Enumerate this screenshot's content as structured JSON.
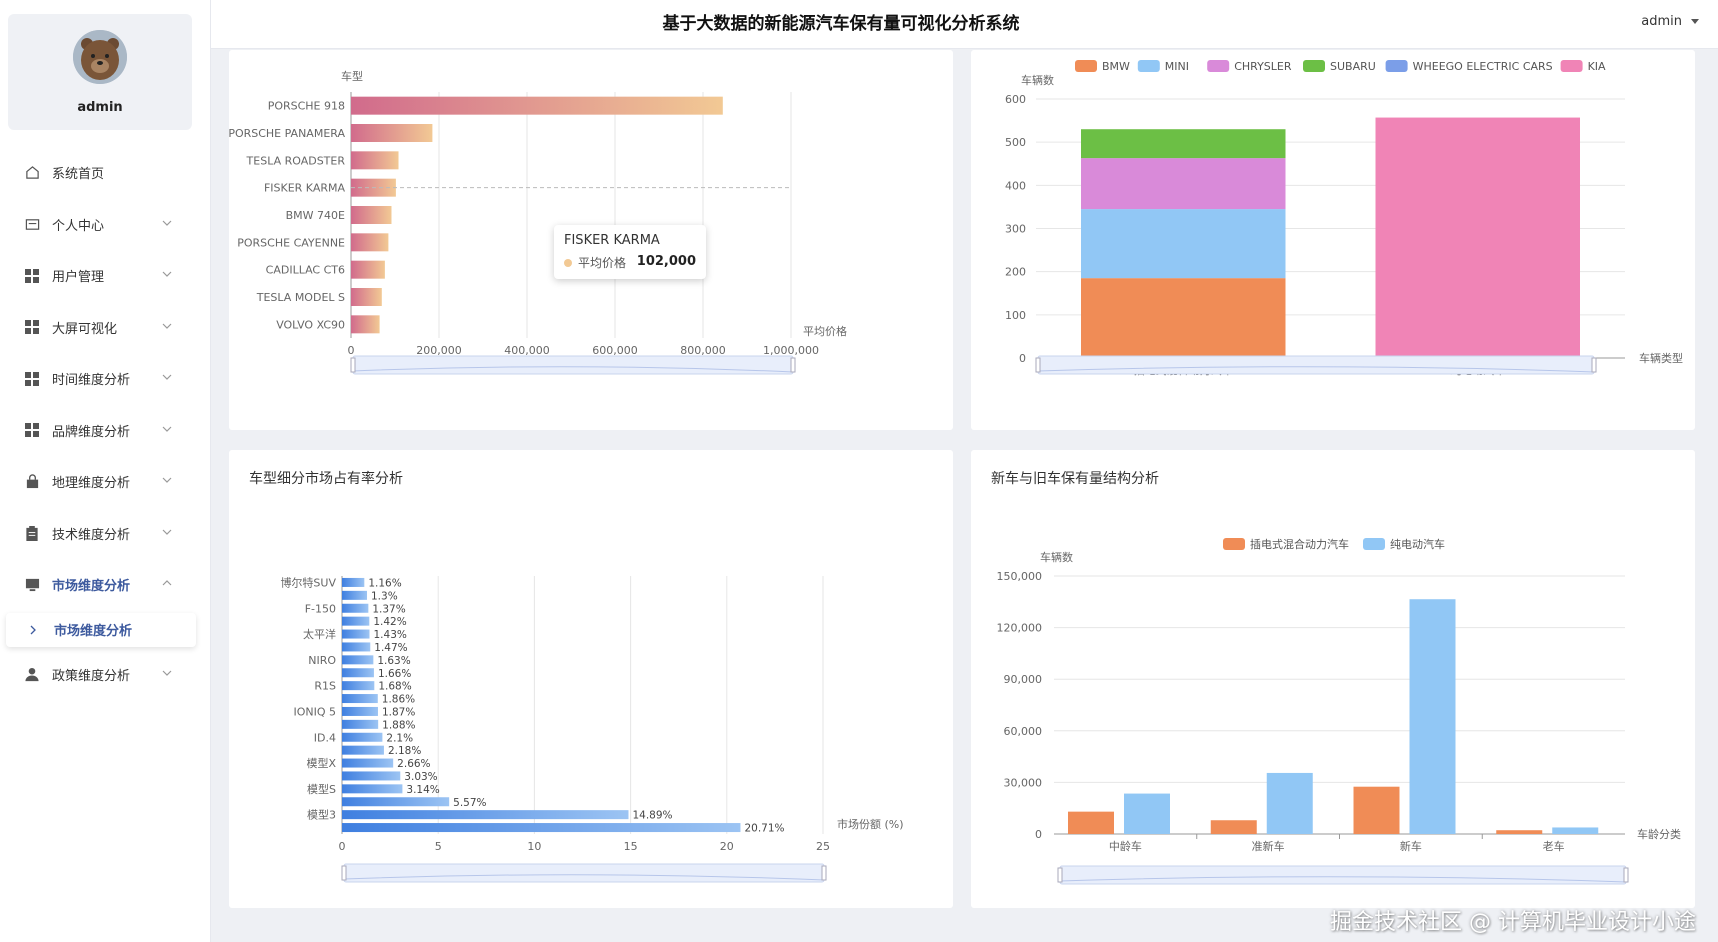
{
  "app": {
    "title": "基于大数据的新能源汽车保有量可视化分析系统",
    "user": "admin"
  },
  "sidebar": {
    "username": "admin",
    "items": [
      {
        "label": "系统首页",
        "icon": "home-icon"
      },
      {
        "label": "个人中心",
        "icon": "id-card-icon"
      },
      {
        "label": "用户管理",
        "icon": "grid-icon"
      },
      {
        "label": "大屏可视化",
        "icon": "grid-icon"
      },
      {
        "label": "时间维度分析",
        "icon": "grid-icon"
      },
      {
        "label": "品牌维度分析",
        "icon": "grid-icon"
      },
      {
        "label": "地理维度分析",
        "icon": "bag-icon"
      },
      {
        "label": "技术维度分析",
        "icon": "clipboard-icon"
      },
      {
        "label": "市场维度分析",
        "icon": "monitor-icon"
      },
      {
        "label": "政策维度分析",
        "icon": "person-icon"
      }
    ],
    "submenu": {
      "label": "市场维度分析"
    }
  },
  "colors": {
    "accent": "#3d5a9e",
    "bmw": "#f08c56",
    "mini": "#91c7f5",
    "chrysler": "#d98ad9",
    "subaru": "#6cbf45",
    "wheego": "#7b9ee8",
    "kia": "#f084b6",
    "share_bar": "#4a8ae8"
  },
  "tooltip": {
    "title": "FISKER KARMA",
    "label": "平均价格",
    "value": "102,000"
  },
  "watermark": "掘金技术社区 @ 计算机毕业设计小途",
  "chart_data": [
    {
      "id": "avg_price",
      "type": "bar",
      "orientation": "horizontal",
      "title": "",
      "xlabel": "平均价格",
      "ylabel": "车型",
      "categories": [
        "PORSCHE 918",
        "PORSCHE PANAMERA",
        "TESLA ROADSTER",
        "FISKER KARMA",
        "BMW 740E",
        "PORSCHE CAYENNE",
        "CADILLAC CT6",
        "TESLA MODEL S",
        "VOLVO XC90"
      ],
      "values": [
        845000,
        185000,
        108000,
        102000,
        92000,
        85000,
        77000,
        70000,
        65000
      ],
      "xlim": [
        0,
        1000000
      ],
      "xticks": [
        "0",
        "200,000",
        "400,000",
        "600,000",
        "800,000",
        "1,000,000"
      ],
      "grid": true
    },
    {
      "id": "brand_type",
      "type": "bar",
      "stacked": true,
      "title": "",
      "xlabel": "车辆类型",
      "ylabel": "车辆数",
      "categories": [
        "插电式混合动力汽车",
        "纯电动汽车"
      ],
      "series": [
        {
          "name": "BMW",
          "values": [
            185,
            0
          ]
        },
        {
          "name": "MINI",
          "values": [
            160,
            0
          ]
        },
        {
          "name": "CHRYSLER",
          "values": [
            118,
            0
          ]
        },
        {
          "name": "SUBARU",
          "values": [
            67,
            0
          ]
        },
        {
          "name": "WHEEGO ELECTRIC CARS",
          "values": [
            0,
            0
          ]
        },
        {
          "name": "KIA",
          "values": [
            0,
            557
          ]
        }
      ],
      "ylim": [
        0,
        600
      ],
      "yticks": [
        "0",
        "100",
        "200",
        "300",
        "400",
        "500",
        "600"
      ],
      "legend": "top"
    },
    {
      "id": "segment_share",
      "type": "bar",
      "orientation": "horizontal",
      "title": "车型细分市场占有率分析",
      "xlabel": "市场份额 (%)",
      "ylabel": "",
      "categories": [
        "博尔特SUV",
        "",
        "F-150",
        "",
        "太平洋",
        "",
        "NIRO",
        "",
        "R1S",
        "",
        "IONIQ 5",
        "",
        "ID.4",
        "",
        "模型X",
        "",
        "模型S",
        "",
        "模型3",
        ""
      ],
      "values": [
        1.16,
        1.3,
        1.37,
        1.42,
        1.43,
        1.47,
        1.63,
        1.66,
        1.68,
        1.86,
        1.87,
        1.88,
        2.1,
        2.18,
        2.66,
        3.03,
        3.14,
        5.57,
        14.89,
        20.71
      ],
      "labels": [
        "1.16%",
        "1.3%",
        "1.37%",
        "1.42%",
        "1.43%",
        "1.47%",
        "1.63%",
        "1.66%",
        "1.68%",
        "1.86%",
        "1.87%",
        "1.88%",
        "2.1%",
        "2.18%",
        "2.66%",
        "3.03%",
        "3.14%",
        "5.57%",
        "14.89%",
        "20.71%"
      ],
      "xlim": [
        0,
        25
      ],
      "xticks": [
        "0",
        "5",
        "10",
        "15",
        "20",
        "25"
      ],
      "grid": true
    },
    {
      "id": "age_structure",
      "type": "bar",
      "title": "新车与旧车保有量结构分析",
      "xlabel": "车龄分类",
      "ylabel": "车辆数",
      "categories": [
        "中龄车",
        "准新车",
        "新车",
        "老车"
      ],
      "series": [
        {
          "name": "插电式混合动力汽车",
          "values": [
            13000,
            8000,
            27500,
            2200
          ]
        },
        {
          "name": "纯电动汽车",
          "values": [
            23500,
            35500,
            136500,
            3800
          ]
        }
      ],
      "ylim": [
        0,
        150000
      ],
      "yticks": [
        "0",
        "30,000",
        "60,000",
        "90,000",
        "120,000",
        "150,000"
      ],
      "legend": "top"
    }
  ]
}
